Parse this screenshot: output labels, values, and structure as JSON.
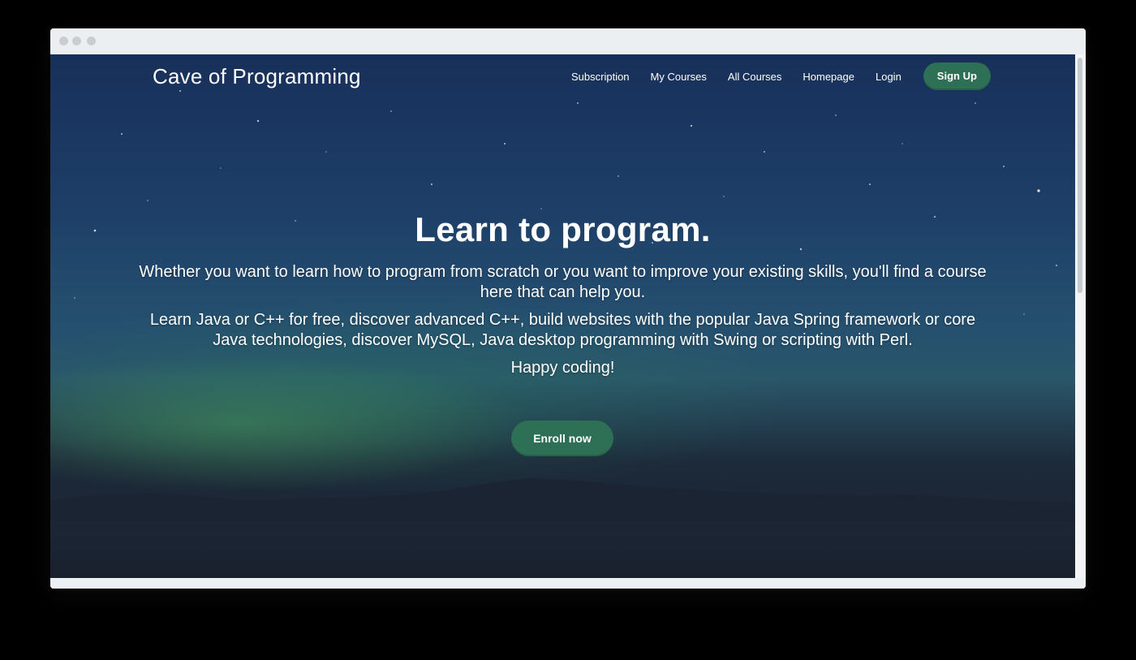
{
  "window": {
    "controls": [
      "window-dot-close",
      "window-dot-minimize",
      "window-dot-zoom"
    ]
  },
  "site": {
    "brand": "Cave of Programming"
  },
  "nav": {
    "items": [
      {
        "label": "Subscription"
      },
      {
        "label": "My Courses"
      },
      {
        "label": "All Courses"
      },
      {
        "label": "Homepage"
      },
      {
        "label": "Login"
      }
    ],
    "signup_label": "Sign Up"
  },
  "hero": {
    "title": "Learn to program.",
    "paragraph1": "Whether you want to learn how to program from scratch or you want to improve your existing skills, you'll find a course here that can help you.",
    "paragraph2": "Learn Java or C++ for free, discover advanced C++, build websites with the popular Java Spring framework or core Java technologies, discover MySQL, Java desktop programming with Swing or scripting with Perl.",
    "paragraph3": "Happy coding!",
    "cta_label": "Enroll now"
  },
  "colors": {
    "accent": "#2e7055",
    "sky_top": "#17305a",
    "aurora": "#46965a",
    "text": "#ffffff"
  }
}
